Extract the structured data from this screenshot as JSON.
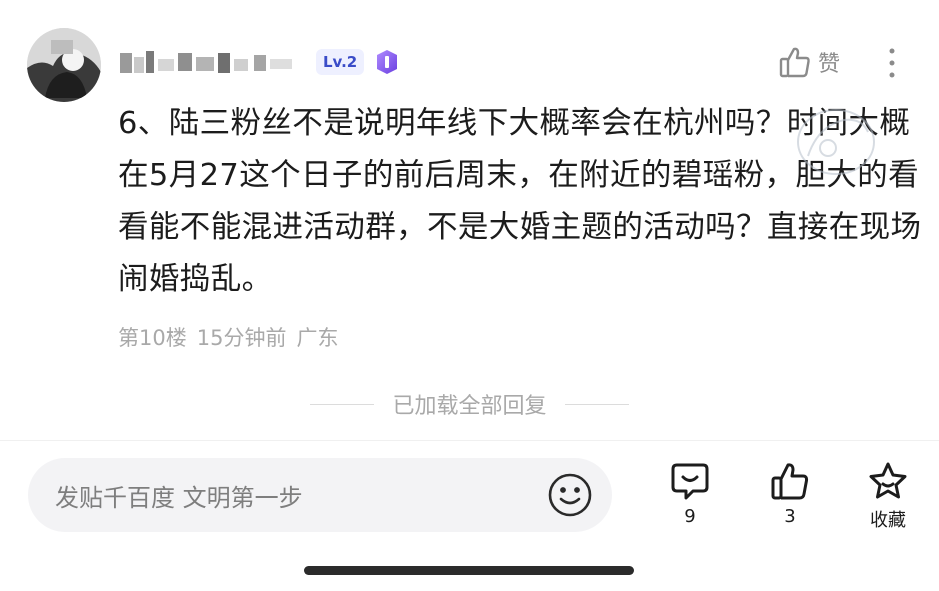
{
  "comment": {
    "level_badge": "Lv.2",
    "like_label": "赞",
    "text": "6、陆三粉丝不是说明年线下大概率会在杭州吗？时间大概在5月27这个日子的前后周末，在附近的碧瑶粉，胆大的看看能不能混进活动群，不是大婚主题的活动吗？直接在现场闹婚捣乱。",
    "meta": {
      "floor": "第10楼",
      "time": "15分钟前",
      "location": "广东"
    }
  },
  "all_loaded_text": "已加载全部回复",
  "bottom_bar": {
    "input_placeholder": "发贴千百度 文明第一步",
    "comment_count": "9",
    "like_count": "3",
    "favorite_label": "收藏"
  },
  "icons": {
    "like": "thumbs-up-icon",
    "more": "more-vertical-icon",
    "emoji": "emoji-icon",
    "comment": "comment-icon",
    "favorite": "star-icon"
  },
  "colors": {
    "text_primary": "#1c1c1c",
    "text_secondary": "#a9a9a9",
    "level_badge": "#3a4cc8",
    "input_bg": "#f3f3f5"
  }
}
